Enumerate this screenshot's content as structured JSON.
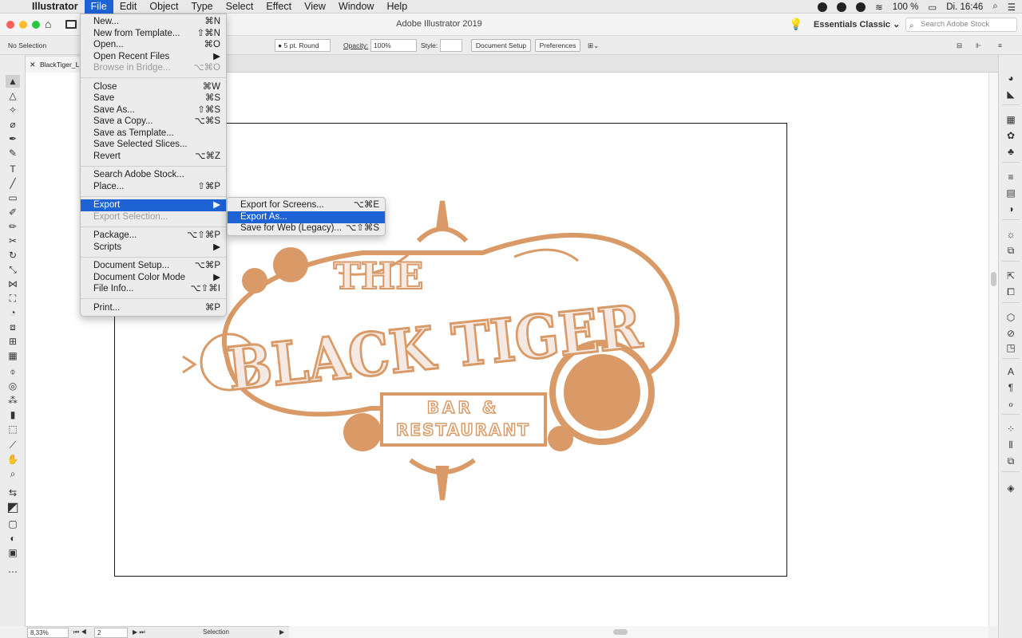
{
  "menubar": {
    "app": "Illustrator",
    "items": [
      "File",
      "Edit",
      "Object",
      "Type",
      "Select",
      "Effect",
      "View",
      "Window",
      "Help"
    ],
    "battery": "100 %",
    "clock": "Di. 16:46"
  },
  "appbar": {
    "title": "Adobe Illustrator 2019",
    "workspace": "Essentials Classic",
    "search_placeholder": "Search Adobe Stock"
  },
  "controlbar": {
    "selection": "No Selection",
    "brush": "5 pt. Round",
    "opacity_label": "Opacity:",
    "opacity_value": "100%",
    "style_label": "Style:",
    "document_setup": "Document Setup",
    "preferences": "Preferences"
  },
  "tab": {
    "name": "BlackTiger_L"
  },
  "file_menu": {
    "items": [
      {
        "label": "New...",
        "shortcut": "⌘N"
      },
      {
        "label": "New from Template...",
        "shortcut": "⇧⌘N"
      },
      {
        "label": "Open...",
        "shortcut": "⌘O"
      },
      {
        "label": "Open Recent Files",
        "shortcut": "▶"
      },
      {
        "label": "Browse in Bridge...",
        "shortcut": "⌥⌘O"
      },
      {
        "label": "Close",
        "shortcut": "⌘W"
      },
      {
        "label": "Save",
        "shortcut": "⌘S"
      },
      {
        "label": "Save As...",
        "shortcut": "⇧⌘S"
      },
      {
        "label": "Save a Copy...",
        "shortcut": "⌥⌘S"
      },
      {
        "label": "Save as Template...",
        "shortcut": ""
      },
      {
        "label": "Save Selected Slices...",
        "shortcut": ""
      },
      {
        "label": "Revert",
        "shortcut": "⌥⌘Z"
      },
      {
        "label": "Search Adobe Stock...",
        "shortcut": ""
      },
      {
        "label": "Place...",
        "shortcut": "⇧⌘P"
      },
      {
        "label": "Export",
        "shortcut": "▶"
      },
      {
        "label": "Export Selection...",
        "shortcut": ""
      },
      {
        "label": "Package...",
        "shortcut": "⌥⇧⌘P"
      },
      {
        "label": "Scripts",
        "shortcut": "▶"
      },
      {
        "label": "Document Setup...",
        "shortcut": "⌥⌘P"
      },
      {
        "label": "Document Color Mode",
        "shortcut": "▶"
      },
      {
        "label": "File Info...",
        "shortcut": "⌥⇧⌘I"
      },
      {
        "label": "Print...",
        "shortcut": "⌘P"
      }
    ]
  },
  "export_submenu": {
    "items": [
      {
        "label": "Export for Screens...",
        "shortcut": "⌥⌘E"
      },
      {
        "label": "Export As...",
        "shortcut": ""
      },
      {
        "label": "Save for Web (Legacy)...",
        "shortcut": "⌥⇧⌘S"
      }
    ]
  },
  "artwork": {
    "line1": "THE",
    "line2": "BLACK TIGER",
    "line3": "BAR &",
    "line4": "RESTAURANT",
    "color": "#d99a67"
  },
  "statusbar": {
    "zoom": "8,33%",
    "page": "2",
    "mode": "Selection"
  }
}
